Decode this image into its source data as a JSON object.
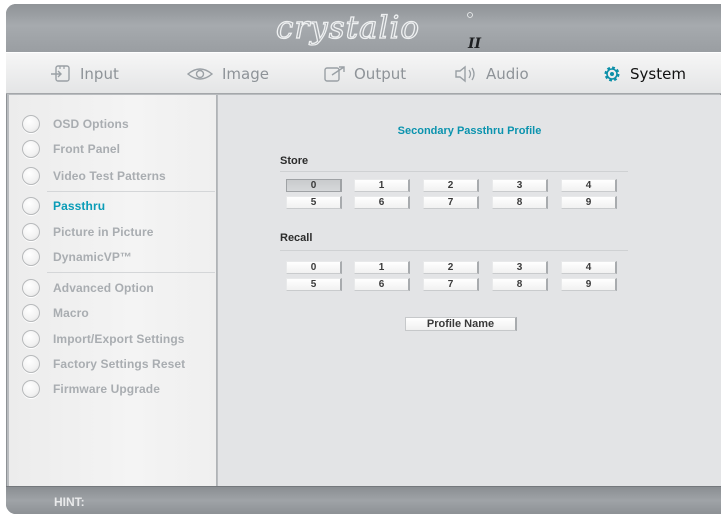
{
  "app": {
    "logo_text": "crystalio II"
  },
  "topnav": {
    "tabs": [
      {
        "label": "Input",
        "icon": "input-icon"
      },
      {
        "label": "Image",
        "icon": "eye-icon"
      },
      {
        "label": "Output",
        "icon": "output-icon"
      },
      {
        "label": "Audio",
        "icon": "speaker-icon"
      },
      {
        "label": "System",
        "icon": "gear-icon",
        "active": true
      }
    ]
  },
  "sidebar": {
    "items": [
      {
        "label": "OSD Options"
      },
      {
        "label": "Front Panel"
      },
      {
        "label": "Video Test Patterns"
      },
      {
        "label": "Passthru",
        "selected": true
      },
      {
        "label": "Picture in Picture"
      },
      {
        "label": "DynamicVP™"
      },
      {
        "label": "Advanced Option"
      },
      {
        "label": "Macro"
      },
      {
        "label": "Import/Export Settings"
      },
      {
        "label": "Factory Settings Reset"
      },
      {
        "label": "Firmware Upgrade"
      }
    ]
  },
  "main": {
    "title": "Secondary Passthru Profile",
    "store": {
      "label": "Store",
      "buttons": [
        "0",
        "1",
        "2",
        "3",
        "4",
        "5",
        "6",
        "7",
        "8",
        "9"
      ],
      "pressed": "0"
    },
    "recall": {
      "label": "Recall",
      "buttons": [
        "0",
        "1",
        "2",
        "3",
        "4",
        "5",
        "6",
        "7",
        "8",
        "9"
      ]
    },
    "profile_name_button": "Profile Name"
  },
  "hint": {
    "label": "HINT:"
  },
  "colors": {
    "accent": "#0a9cb7",
    "chrome": "#b9bcbf",
    "panel": "#e3e4e6"
  }
}
